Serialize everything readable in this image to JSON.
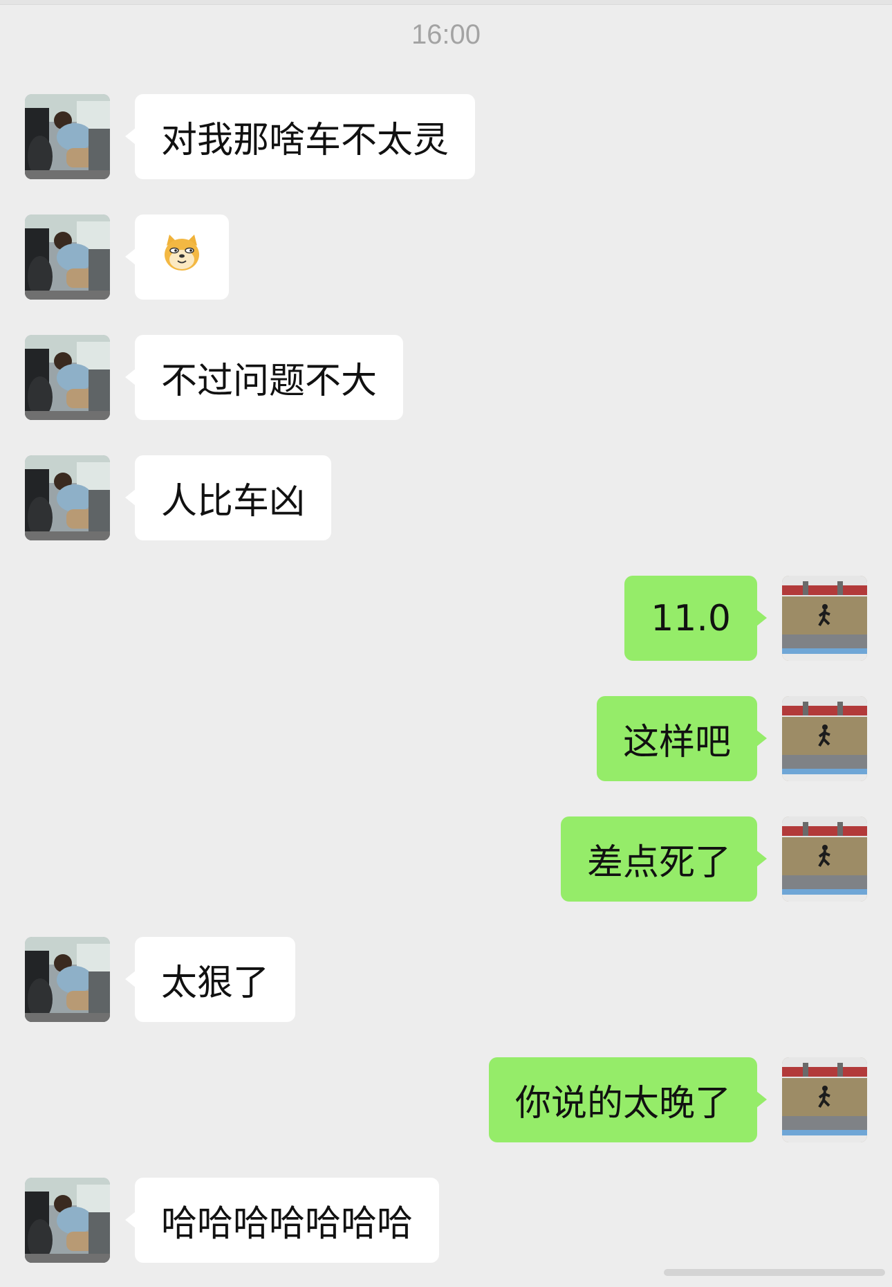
{
  "timestamp": "16:00",
  "messages": [
    {
      "side": "left",
      "text": "对我那啥车不太灵",
      "type": "text"
    },
    {
      "side": "left",
      "text": "",
      "type": "emoji",
      "emoji": "doge-emoji"
    },
    {
      "side": "left",
      "text": "不过问题不大",
      "type": "text"
    },
    {
      "side": "left",
      "text": "人比车凶",
      "type": "text"
    },
    {
      "side": "right",
      "text": "11.0",
      "type": "text"
    },
    {
      "side": "right",
      "text": "这样吧",
      "type": "text"
    },
    {
      "side": "right",
      "text": "差点死了",
      "type": "text"
    },
    {
      "side": "left",
      "text": "太狠了",
      "type": "text"
    },
    {
      "side": "right",
      "text": "你说的太晚了",
      "type": "text"
    },
    {
      "side": "left",
      "text": "哈哈哈哈哈哈哈",
      "type": "text"
    }
  ],
  "colors": {
    "background": "#ededed",
    "incoming_bubble": "#ffffff",
    "outgoing_bubble": "#95ec69",
    "timestamp": "#a3a3a3"
  }
}
